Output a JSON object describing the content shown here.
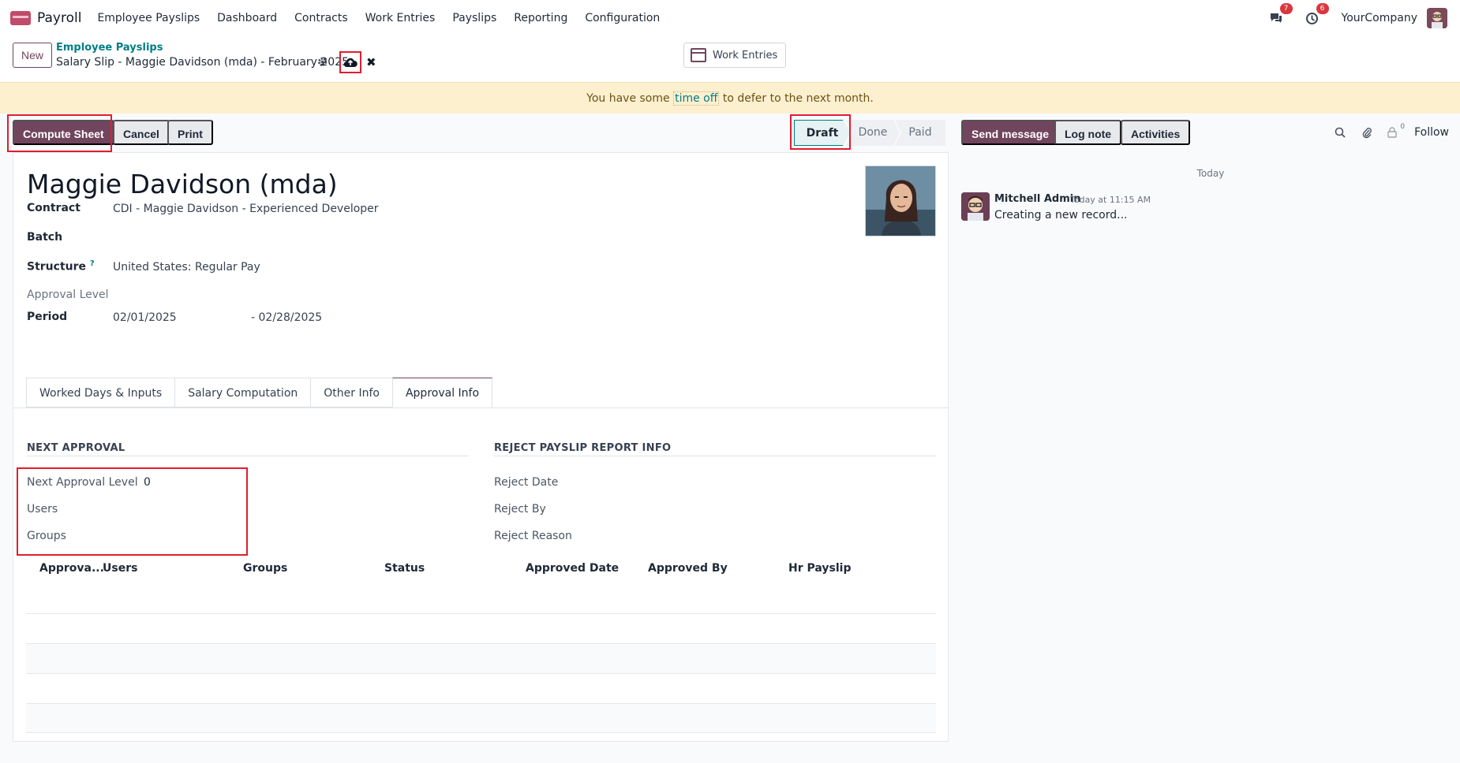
{
  "navbar": {
    "app_name": "Payroll",
    "menu": [
      "Employee Payslips",
      "Dashboard",
      "Contracts",
      "Work Entries",
      "Payslips",
      "Reporting",
      "Configuration"
    ],
    "messages_badge": "7",
    "activities_badge": "6",
    "company": "YourCompany"
  },
  "control": {
    "new_label": "New",
    "breadcrumb_parent": "Employee Payslips",
    "breadcrumb_current": "Salary Slip - Maggie Davidson (mda) - February 2025",
    "work_entries_label": "Work Entries"
  },
  "alert": {
    "prefix": "You have some ",
    "link": "time off",
    "suffix": " to defer to the next month."
  },
  "actions": {
    "compute_sheet": "Compute Sheet",
    "cancel": "Cancel",
    "print": "Print"
  },
  "status": {
    "stages": [
      "Draft",
      "Done",
      "Paid"
    ],
    "current": "Draft"
  },
  "form": {
    "employee_name": "Maggie Davidson (mda)",
    "contract_label": "Contract",
    "contract_value": "CDI - Maggie Davidson - Experienced Developer",
    "batch_label": "Batch",
    "structure_label": "Structure",
    "structure_help": "?",
    "structure_value": "United States: Regular Pay",
    "approval_level_label": "Approval Level",
    "period_label": "Period",
    "period_start": "02/01/2025",
    "period_end": "- 02/28/2025"
  },
  "tabs": [
    "Worked Days & Inputs",
    "Salary Computation",
    "Other Info",
    "Approval Info"
  ],
  "active_tab": "Approval Info",
  "approval": {
    "next_title": "NEXT APPROVAL",
    "next_level_label": "Next Approval Level",
    "next_level_value": "0",
    "users_label": "Users",
    "groups_label": "Groups",
    "reject_title": "REJECT PAYSLIP REPORT INFO",
    "reject_date_label": "Reject Date",
    "reject_by_label": "Reject By",
    "reject_reason_label": "Reject Reason",
    "columns": [
      "Approva...",
      "Users",
      "Groups",
      "Status",
      "Approved Date",
      "Approved By",
      "Hr Payslip"
    ]
  },
  "chatter": {
    "send_message": "Send message",
    "log_note": "Log note",
    "activities": "Activities",
    "attachments_count": "0",
    "follow": "Follow",
    "date_separator": "Today",
    "message": {
      "author": "Mitchell Admin",
      "time": "Today at 11:15 AM",
      "body": "Creating a new record..."
    }
  },
  "colors": {
    "primary": "#71455e",
    "link": "#017e84",
    "highlight": "#e11d2e",
    "alert_bg": "#fdf0cf"
  }
}
